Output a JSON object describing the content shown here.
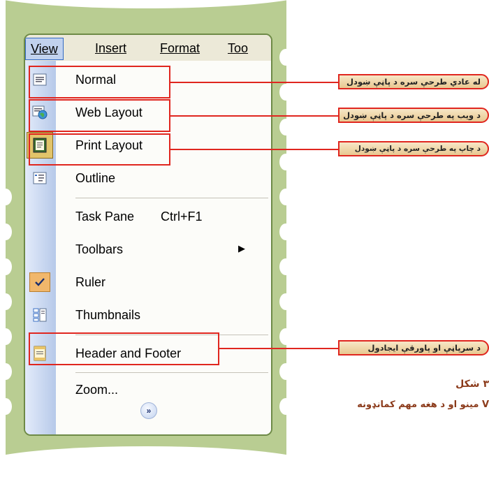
{
  "menubar": {
    "view": "View",
    "insert": "Insert",
    "format": "Format",
    "tools": "Too"
  },
  "menu_items": {
    "normal": {
      "label": "Normal",
      "icon": "normal-view-icon"
    },
    "web_layout": {
      "label": "Web Layout",
      "icon": "web-layout-icon"
    },
    "print_layout": {
      "label": "Print Layout",
      "icon": "print-layout-icon"
    },
    "outline": {
      "label": "Outline",
      "icon": "outline-icon"
    },
    "task_pane": {
      "label": "Task Pane",
      "shortcut": "Ctrl+F1"
    },
    "toolbars": {
      "label": "Toolbars"
    },
    "ruler": {
      "label": "Ruler",
      "icon": "checkmark-icon"
    },
    "thumbnails": {
      "label": "Thumbnails",
      "icon": "thumbnails-icon"
    },
    "header_footer": {
      "label": "Header and Footer",
      "icon": "header-footer-icon"
    },
    "zoom": {
      "label": "Zoom..."
    },
    "expand": {
      "icon": "expand-chevron-icon"
    }
  },
  "callouts": {
    "normal": "له عادي طرحې سره د پاڼې ښودل",
    "web_layout": "د ويب په طرحې سره د پاڼې ښودل",
    "print_layout": "د چاپ په طرحې سره د پاڼې ښودل",
    "header_footer": "د سرپاڼې او پاورقې ايجادول"
  },
  "caption": {
    "figure_number": "۳ شکل",
    "description": "V مينو او د هغه مهم کمانډونه"
  },
  "colors": {
    "frame_green": "#b9cd92",
    "highlight_red": "#e0261f",
    "callout_fill": "#f2dcae",
    "caption_brown": "#8b3a1a",
    "menu_selection": "#c1d2ee"
  }
}
